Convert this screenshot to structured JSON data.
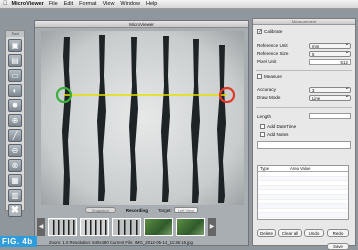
{
  "menubar": {
    "apple_glyph": "",
    "app_name": "MicroViewer",
    "items": [
      "File",
      "Edit",
      "Format",
      "View",
      "Window",
      "Help"
    ]
  },
  "toolbox": {
    "title": "Tool",
    "tools": [
      {
        "name": "camera-icon",
        "glyph": "▣"
      },
      {
        "name": "image-icon",
        "glyph": "▤"
      },
      {
        "name": "frame-icon",
        "glyph": "▭"
      },
      {
        "name": "adjust-icon",
        "glyph": "◐"
      },
      {
        "name": "settings-icon",
        "glyph": "✸"
      },
      {
        "name": "zoom-in-icon",
        "glyph": "⊕"
      },
      {
        "name": "measure-icon",
        "glyph": "╱"
      },
      {
        "name": "zoom-out-icon",
        "glyph": "⊖"
      },
      {
        "name": "zoom-fit-icon",
        "glyph": "⊗"
      },
      {
        "name": "film-icon",
        "glyph": "▦"
      },
      {
        "name": "trash-icon",
        "glyph": "▥"
      },
      {
        "name": "close-icon",
        "glyph": "✖"
      }
    ]
  },
  "viewer": {
    "title": "MicroViewer",
    "snapshot_label": "Snapshot",
    "recording_label": "Recording",
    "target_label": "Target:",
    "target_value": "Left View",
    "status": "Zoom: 1.0   Resolution: 640x480   Current File: IMG_2012-05-14_11:36:16.jpg",
    "measure_line_color": "#e8e000",
    "start_marker_color": "#3ab03a",
    "end_marker_color": "#e03a2a"
  },
  "panel": {
    "title": "Measurement",
    "calibrate_label": "Calibrate",
    "reference_unit_label": "Reference Unit",
    "reference_unit_value": "mm",
    "reference_size_label": "Reference Size",
    "reference_size_value": "5",
    "pixel_unit_label": "Pixel Unit",
    "pixel_unit_value": "512",
    "measure_label": "Measure",
    "accuracy_label": "Accuracy",
    "accuracy_value": "3",
    "draw_mode_label": "Draw Mode",
    "draw_mode_value": "Line",
    "length_label": "Length",
    "add_datetime_label": "Add DateTime",
    "add_notes_label": "Add Notes",
    "table_col_type": "Type",
    "table_col_value": "Area Value",
    "buttons": {
      "delete": "Delete",
      "clear_all": "Clear all",
      "undo": "Undo",
      "redo": "Redo",
      "save": "Save"
    }
  },
  "caption": {
    "text": "FIG. 4b"
  }
}
